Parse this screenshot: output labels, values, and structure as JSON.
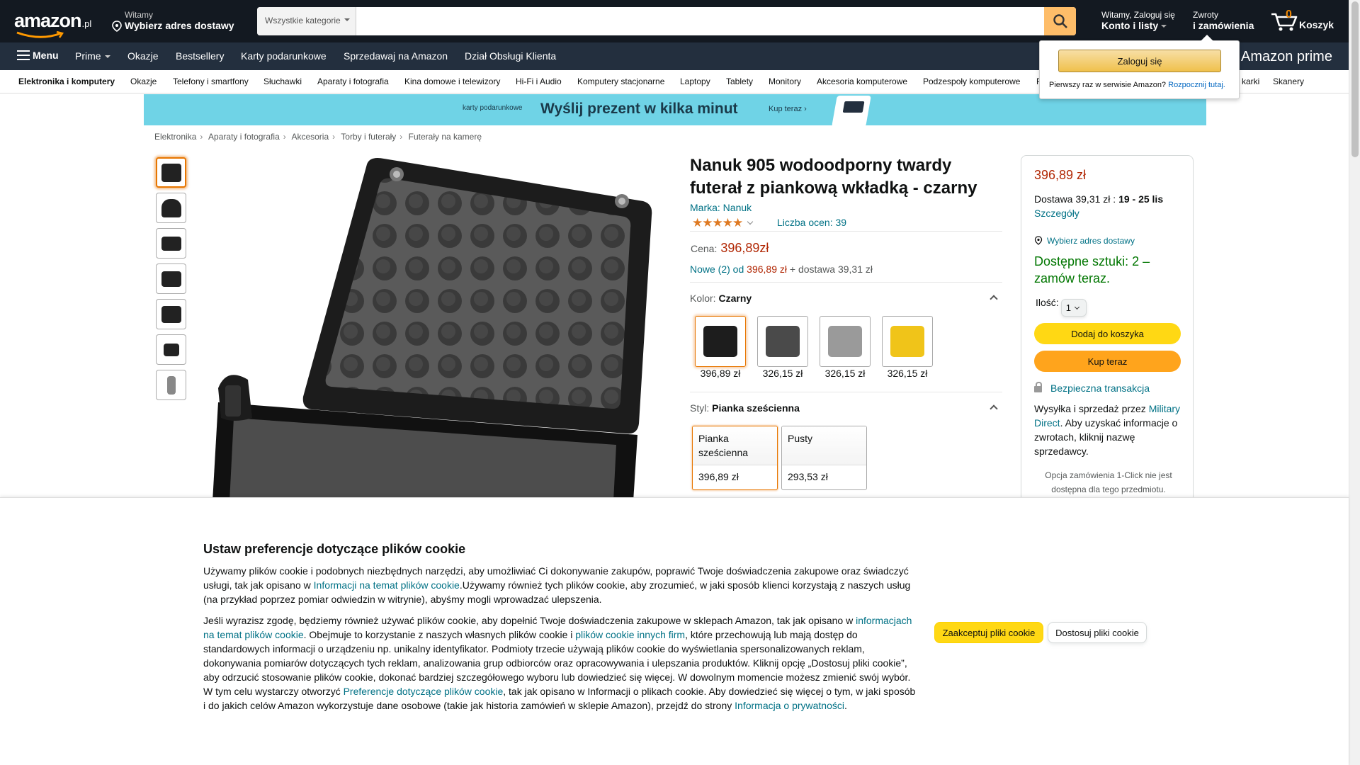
{
  "header": {
    "logo_text": "amazon",
    "logo_tld": ".pl",
    "deliver_line1": "Witamy",
    "deliver_line2": "Wybierz adres dostawy",
    "search_category": "Wszystkie kategorie",
    "search_placeholder": "",
    "account_line1": "Witamy, Zaloguj się",
    "account_line2": "Konto i listy",
    "orders_line1": "Zwroty",
    "orders_line2": "i zamówienia",
    "cart_count": "0",
    "cart_label": "Koszyk"
  },
  "nav": {
    "menu_label": "Menu",
    "items": [
      "Prime",
      "Okazje",
      "Bestsellery",
      "Karty podarunkowe",
      "Sprzedawaj na Amazon",
      "Dział Obsługi Klienta"
    ],
    "prime_ad": "Amazon prime"
  },
  "subnav": {
    "items": [
      "Elektronika i komputery",
      "Okazje",
      "Telefony i smartfony",
      "Słuchawki",
      "Aparaty i fotografia",
      "Kina domowe i telewizory",
      "Hi-Fi i Audio",
      "Komputery stacjonarne",
      "Laptopy",
      "Tablety",
      "Monitory",
      "Akcesoria komputerowe",
      "Podzespoły komputerowe",
      "P",
      "karki",
      "Skanery"
    ]
  },
  "signin_flyout": {
    "button": "Zaloguj się",
    "new_customer": "Pierwszy raz w serwisie Amazon?",
    "start_link": "Rozpocznij tutaj."
  },
  "banner": {
    "small": "karty podarunkowe",
    "headline": "Wyślij prezent w kilka minut",
    "cta": "Kup teraz ›"
  },
  "breadcrumb": [
    "Elektronika",
    "Aparaty i fotografia",
    "Akcesoria",
    "Torby i futerały",
    "Futerały na kamerę"
  ],
  "product": {
    "title": "Nanuk 905 wodoodporny twardy futerał z piankową wkładką - czarny",
    "brand": "Marka: Nanuk",
    "stars": "★★★★★",
    "rating_value": 4.5,
    "rating_count": "Liczba ocen: 39",
    "price_label": "Cena:",
    "price": "396,89zł",
    "new_link": "Nowe (2) od",
    "new_price": "396,89 zł",
    "new_shipping": "+ dostawa 39,31 zł",
    "color_label": "Kolor:",
    "color_value": "Czarny",
    "color_options": [
      {
        "price": "396,89 zł",
        "color": "#1d1d1d"
      },
      {
        "price": "326,15 zł",
        "color": "#4a4a4a"
      },
      {
        "price": "326,15 zł",
        "color": "#9a9a9a"
      },
      {
        "price": "326,15 zł",
        "color": "#f0c419"
      }
    ],
    "style_label": "Styl:",
    "style_value": "Pianka sześcienna",
    "style_options": [
      {
        "name": "Pianka sześcienna",
        "price": "396,89 zł"
      },
      {
        "name": "Pusty",
        "price": "293,53 zł"
      }
    ],
    "thumb_count": 7
  },
  "buybox": {
    "price": "396,89 zł",
    "delivery_prefix": "Dostawa 39,31 zł :",
    "delivery_dates": "19 - 25 lis",
    "details_link": "Szczegóły",
    "address_link": "Wybierz adres dostawy",
    "stock": "Dostępne sztuki: 2 – zamów teraz.",
    "qty_label": "Ilość:",
    "qty_value": "1",
    "add_to_cart": "Dodaj do koszyka",
    "buy_now": "Kup teraz",
    "secure": "Bezpieczna transakcja",
    "seller_prefix": "Wysyłka i sprzedaż przez",
    "seller_name": "Military Direct",
    "seller_suffix": ". Aby uzyskać informacje o zwrotach, kliknij nazwę sprzedawcy.",
    "oneclick": "Opcja zamówienia 1-Click nie jest dostępna dla tego przedmiotu."
  },
  "cookie": {
    "title": "Ustaw preferencje dotyczące plików cookie",
    "p1_a": "Używamy plików cookie i podobnych niezbędnych narzędzi, aby umożliwiać Ci dokonywanie zakupów, poprawić Twoje doświadczenia zakupowe oraz świadczyć usługi, tak jak opisano w ",
    "p1_link": "Informacji na temat plików cookie",
    "p1_b": ".Używamy również tych plików cookie, aby zrozumieć, w jaki sposób klienci korzystają z naszych usług (na przykład poprzez pomiar odwiedzin w witrynie), abyśmy mogli wprowadzać ulepszenia.",
    "p2_a": "Jeśli wyrazisz zgodę, będziemy również używać plików cookie, aby dopełnić Twoje doświadczenia zakupowe w sklepach Amazon, tak jak opisano w ",
    "p2_link1": "informacjach na temat plików cookie",
    "p2_b": ". Obejmuje to korzystanie z naszych własnych plików cookie i ",
    "p2_link2": "plików cookie innych firm",
    "p2_c": ", które przechowują lub mają dostęp do standardowych informacji o urządzeniu np. unikalny identyfikator. Podmioty trzecie używają plików cookie do wyświetlania spersonalizowanych reklam, dokonywania pomiarów dotyczących tych reklam, analizowania grup odbiorców oraz opracowywania i ulepszania produktów. Kliknij opcję „Dostosuj pliki cookie”, aby odrzucić stosowanie plików cookie, dokonać bardziej szczegółowego wyboru lub dowiedzieć się więcej. W dowolnym momencie możesz zmienić swój wybór. W tym celu wystarczy otworzyć ",
    "p2_link3": "Preferencje dotyczące plików cookie",
    "p2_d": ", tak jak opisano w Informacji o plikach cookie. Aby dowiedzieć się więcej o tym, w jaki sposób i do jakich celów Amazon wykorzystuje dane osobowe (takie jak historia zamówień w sklepie Amazon), przejdź do strony ",
    "p2_link4": "Informacja o prywatności",
    "p2_e": ".",
    "accept": "Zaakceptuj pliki cookie",
    "customize": "Dostosuj pliki cookie"
  },
  "colors": {
    "nav_bg": "#131921",
    "nav2_bg": "#232f3e",
    "accent_orange": "#febd69",
    "price_red": "#b12704",
    "link_teal": "#007185",
    "stock_green": "#007600",
    "button_yellow": "#ffd814",
    "button_orange": "#ffa41c"
  }
}
